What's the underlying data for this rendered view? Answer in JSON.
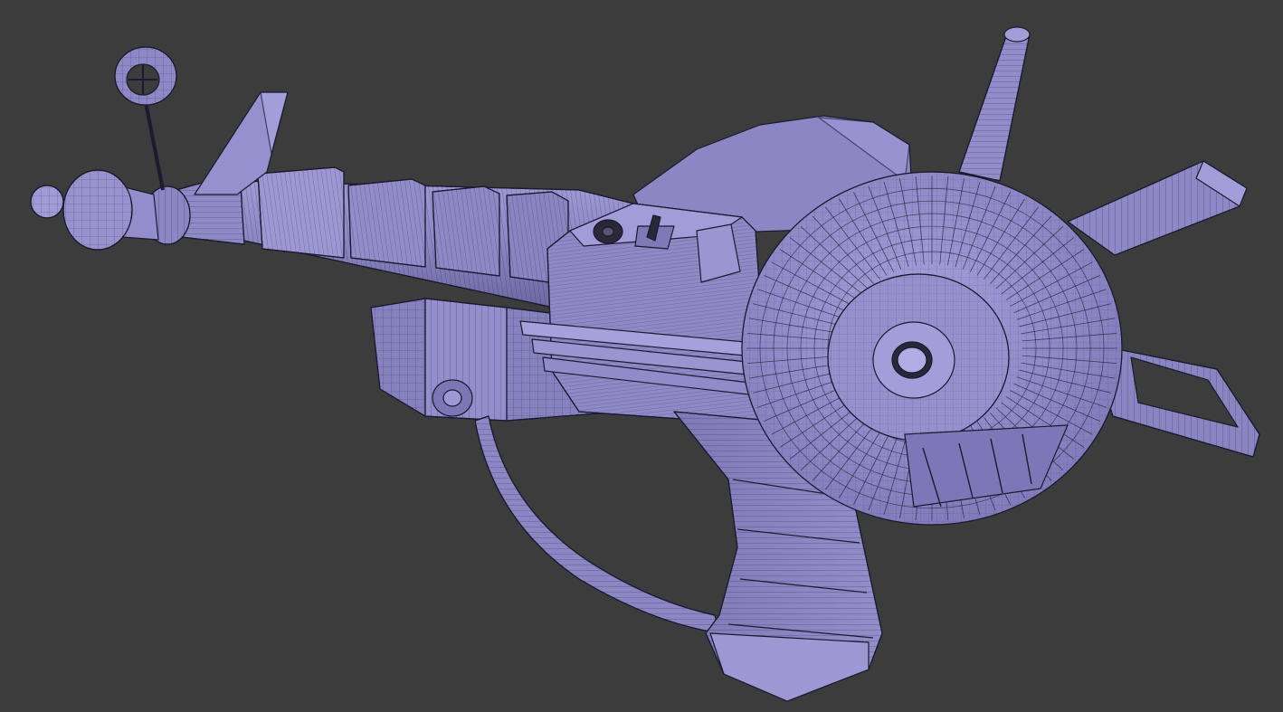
{
  "viewport": {
    "background_color": "#3c3c3c"
  },
  "model": {
    "subject": "ray-gun-wireframe-model",
    "shading_mode": "solid-with-wireframe",
    "fill_color": "#8a84c2",
    "fill_light_color": "#a19cd8",
    "fill_dark_color": "#6d67a3",
    "wire_color": "#1c1a2e"
  }
}
